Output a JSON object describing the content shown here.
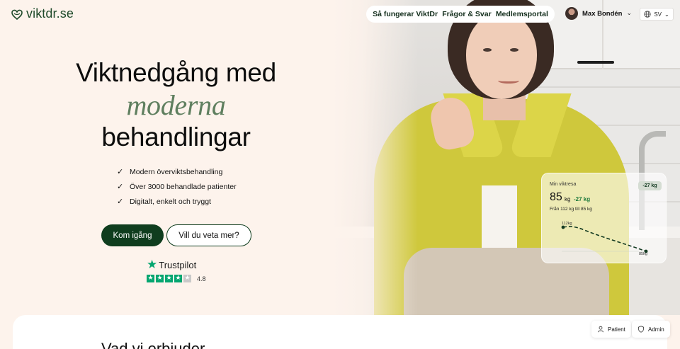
{
  "brand": {
    "name": "viktdr.se",
    "color": "#1f4a2a"
  },
  "nav": {
    "links": [
      "Så fungerar ViktDr",
      "Frågor & Svar",
      "Medlemsportal"
    ]
  },
  "user": {
    "name": "Max Bondén"
  },
  "language": {
    "selected": "SV"
  },
  "hero": {
    "title_line1": "Viktnedgång med",
    "title_emphasis": "moderna",
    "title_line3": "behandlingar",
    "features": [
      "Modern överviktsbehandling",
      "Över 3000 behandlade patienter",
      "Digitalt, enkelt och tryggt"
    ],
    "cta_primary": "Kom igång",
    "cta_secondary": "Vill du veta mer?"
  },
  "trustpilot": {
    "name": "Trustpilot",
    "rating": "4.8",
    "stars_filled": 4,
    "stars_total": 5
  },
  "weight_card": {
    "title": "Min viktresa",
    "badge": "-27 kg",
    "current": "85",
    "unit": "kg",
    "delta": "-27 kg",
    "range_text": "Från 112 kg till 85 kg",
    "start_label": "112kg",
    "end_label": "85kg"
  },
  "section": {
    "title": "Vad vi erbjuder"
  },
  "role_switch": {
    "patient": "Patient",
    "admin": "Admin"
  },
  "colors": {
    "background": "#fdf3ec",
    "primary": "#0f3d1e",
    "accent_green": "#04a670",
    "emphasis": "#5f7f5f"
  }
}
